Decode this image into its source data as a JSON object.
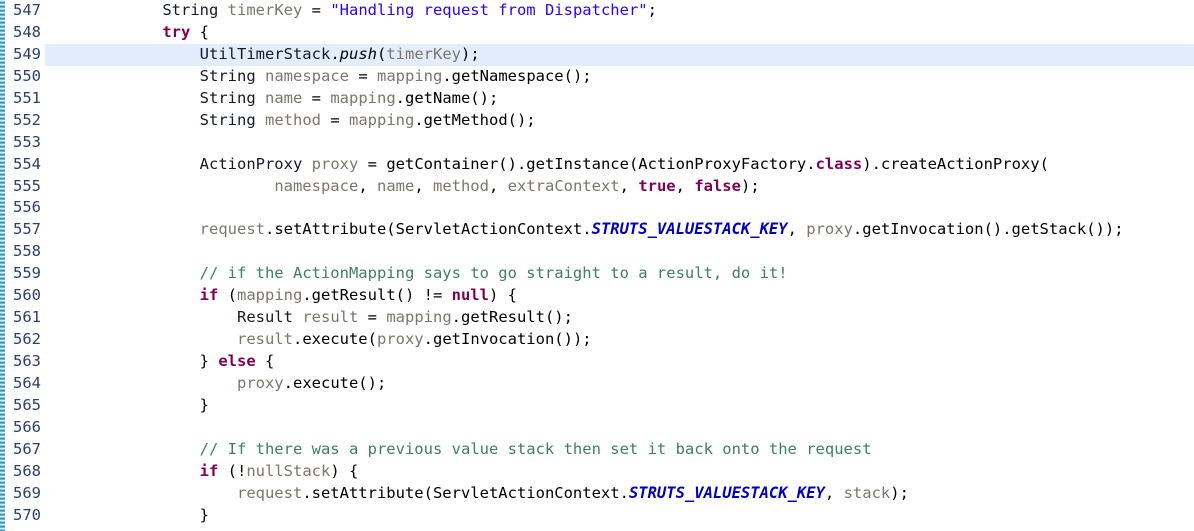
{
  "editor": {
    "first_line_number": 547,
    "last_line_number": 570,
    "highlighted_line": 549,
    "language": "Java",
    "colors": {
      "background": "#ffffff",
      "highlight_row": "#e3ecfb",
      "line_number": "#2c3e6b",
      "keyword": "#7f0055",
      "string": "#2a00ff",
      "comment": "#3f7f5f",
      "static_field": "#0000c0",
      "identifier": "#7d7669",
      "type": "#14192e",
      "change_strip": "#2e8fc0"
    },
    "lines": [
      {
        "number": "547",
        "indent": "    ",
        "tokens": [
          {
            "t": "String",
            "c": "t-type"
          },
          {
            "t": " ",
            "c": "t-plain"
          },
          {
            "t": "timerKey",
            "c": "t-ident"
          },
          {
            "t": " = ",
            "c": "t-plain"
          },
          {
            "t": "\"Handling request from Dispatcher\"",
            "c": "t-str"
          },
          {
            "t": ";",
            "c": "t-plain"
          }
        ]
      },
      {
        "number": "548",
        "indent": "    ",
        "tokens": [
          {
            "t": "try",
            "c": "t-kw"
          },
          {
            "t": " {",
            "c": "t-plain"
          }
        ]
      },
      {
        "number": "549",
        "indent": "        ",
        "tokens": [
          {
            "t": "UtilTimerStack",
            "c": "t-type"
          },
          {
            "t": ".",
            "c": "t-plain"
          },
          {
            "t": "push",
            "c": "t-method-i"
          },
          {
            "t": "(",
            "c": "t-plain"
          },
          {
            "t": "timerKey",
            "c": "t-ident"
          },
          {
            "t": ");",
            "c": "t-plain"
          }
        ]
      },
      {
        "number": "550",
        "indent": "        ",
        "tokens": [
          {
            "t": "String",
            "c": "t-type"
          },
          {
            "t": " ",
            "c": "t-plain"
          },
          {
            "t": "namespace",
            "c": "t-ident"
          },
          {
            "t": " = ",
            "c": "t-plain"
          },
          {
            "t": "mapping",
            "c": "t-ident"
          },
          {
            "t": ".getNamespace();",
            "c": "t-plain"
          }
        ]
      },
      {
        "number": "551",
        "indent": "        ",
        "tokens": [
          {
            "t": "String",
            "c": "t-type"
          },
          {
            "t": " ",
            "c": "t-plain"
          },
          {
            "t": "name",
            "c": "t-ident"
          },
          {
            "t": " = ",
            "c": "t-plain"
          },
          {
            "t": "mapping",
            "c": "t-ident"
          },
          {
            "t": ".getName();",
            "c": "t-plain"
          }
        ]
      },
      {
        "number": "552",
        "indent": "        ",
        "tokens": [
          {
            "t": "String",
            "c": "t-type"
          },
          {
            "t": " ",
            "c": "t-plain"
          },
          {
            "t": "method",
            "c": "t-ident"
          },
          {
            "t": " = ",
            "c": "t-plain"
          },
          {
            "t": "mapping",
            "c": "t-ident"
          },
          {
            "t": ".getMethod();",
            "c": "t-plain"
          }
        ]
      },
      {
        "number": "553",
        "indent": "",
        "tokens": []
      },
      {
        "number": "554",
        "indent": "        ",
        "tokens": [
          {
            "t": "ActionProxy",
            "c": "t-type"
          },
          {
            "t": " ",
            "c": "t-plain"
          },
          {
            "t": "proxy",
            "c": "t-ident"
          },
          {
            "t": " = getContainer().getInstance(ActionProxyFactory.",
            "c": "t-plain"
          },
          {
            "t": "class",
            "c": "t-kw"
          },
          {
            "t": ").createActionProxy(",
            "c": "t-plain"
          }
        ]
      },
      {
        "number": "555",
        "indent": "                ",
        "tokens": [
          {
            "t": "namespace",
            "c": "t-ident"
          },
          {
            "t": ", ",
            "c": "t-plain"
          },
          {
            "t": "name",
            "c": "t-ident"
          },
          {
            "t": ", ",
            "c": "t-plain"
          },
          {
            "t": "method",
            "c": "t-ident"
          },
          {
            "t": ", ",
            "c": "t-plain"
          },
          {
            "t": "extraContext",
            "c": "t-ident"
          },
          {
            "t": ", ",
            "c": "t-plain"
          },
          {
            "t": "true",
            "c": "t-kw"
          },
          {
            "t": ", ",
            "c": "t-plain"
          },
          {
            "t": "false",
            "c": "t-kw"
          },
          {
            "t": ");",
            "c": "t-plain"
          }
        ]
      },
      {
        "number": "556",
        "indent": "",
        "tokens": []
      },
      {
        "number": "557",
        "indent": "        ",
        "tokens": [
          {
            "t": "request",
            "c": "t-ident"
          },
          {
            "t": ".setAttribute(ServletActionContext.",
            "c": "t-plain"
          },
          {
            "t": "STRUTS_VALUESTACK_KEY",
            "c": "t-static"
          },
          {
            "t": ", ",
            "c": "t-plain"
          },
          {
            "t": "proxy",
            "c": "t-ident"
          },
          {
            "t": ".getInvocation().getStack());",
            "c": "t-plain"
          }
        ]
      },
      {
        "number": "558",
        "indent": "",
        "tokens": []
      },
      {
        "number": "559",
        "indent": "        ",
        "tokens": [
          {
            "t": "// if the ActionMapping says to go straight to a result, do it!",
            "c": "t-comment"
          }
        ]
      },
      {
        "number": "560",
        "indent": "        ",
        "tokens": [
          {
            "t": "if",
            "c": "t-kw"
          },
          {
            "t": " (",
            "c": "t-plain"
          },
          {
            "t": "mapping",
            "c": "t-ident"
          },
          {
            "t": ".getResult() != ",
            "c": "t-plain"
          },
          {
            "t": "null",
            "c": "t-kw"
          },
          {
            "t": ") {",
            "c": "t-plain"
          }
        ]
      },
      {
        "number": "561",
        "indent": "            ",
        "tokens": [
          {
            "t": "Result",
            "c": "t-type"
          },
          {
            "t": " ",
            "c": "t-plain"
          },
          {
            "t": "result",
            "c": "t-ident"
          },
          {
            "t": " = ",
            "c": "t-plain"
          },
          {
            "t": "mapping",
            "c": "t-ident"
          },
          {
            "t": ".getResult();",
            "c": "t-plain"
          }
        ]
      },
      {
        "number": "562",
        "indent": "            ",
        "tokens": [
          {
            "t": "result",
            "c": "t-ident"
          },
          {
            "t": ".execute(",
            "c": "t-plain"
          },
          {
            "t": "proxy",
            "c": "t-ident"
          },
          {
            "t": ".getInvocation());",
            "c": "t-plain"
          }
        ]
      },
      {
        "number": "563",
        "indent": "        ",
        "tokens": [
          {
            "t": "} ",
            "c": "t-plain"
          },
          {
            "t": "else",
            "c": "t-kw"
          },
          {
            "t": " {",
            "c": "t-plain"
          }
        ]
      },
      {
        "number": "564",
        "indent": "            ",
        "tokens": [
          {
            "t": "proxy",
            "c": "t-ident"
          },
          {
            "t": ".execute();",
            "c": "t-plain"
          }
        ]
      },
      {
        "number": "565",
        "indent": "        ",
        "tokens": [
          {
            "t": "}",
            "c": "t-plain"
          }
        ]
      },
      {
        "number": "566",
        "indent": "",
        "tokens": []
      },
      {
        "number": "567",
        "indent": "        ",
        "tokens": [
          {
            "t": "// If there was a previous value stack then set it back onto the request",
            "c": "t-comment"
          }
        ]
      },
      {
        "number": "568",
        "indent": "        ",
        "tokens": [
          {
            "t": "if",
            "c": "t-kw"
          },
          {
            "t": " (!",
            "c": "t-plain"
          },
          {
            "t": "nullStack",
            "c": "t-ident"
          },
          {
            "t": ") {",
            "c": "t-plain"
          }
        ]
      },
      {
        "number": "569",
        "indent": "            ",
        "tokens": [
          {
            "t": "request",
            "c": "t-ident"
          },
          {
            "t": ".setAttribute(ServletActionContext.",
            "c": "t-plain"
          },
          {
            "t": "STRUTS_VALUESTACK_KEY",
            "c": "t-static"
          },
          {
            "t": ", ",
            "c": "t-plain"
          },
          {
            "t": "stack",
            "c": "t-ident"
          },
          {
            "t": ");",
            "c": "t-plain"
          }
        ]
      },
      {
        "number": "570",
        "indent": "        ",
        "tokens": [
          {
            "t": "}",
            "c": "t-plain"
          }
        ]
      }
    ]
  }
}
